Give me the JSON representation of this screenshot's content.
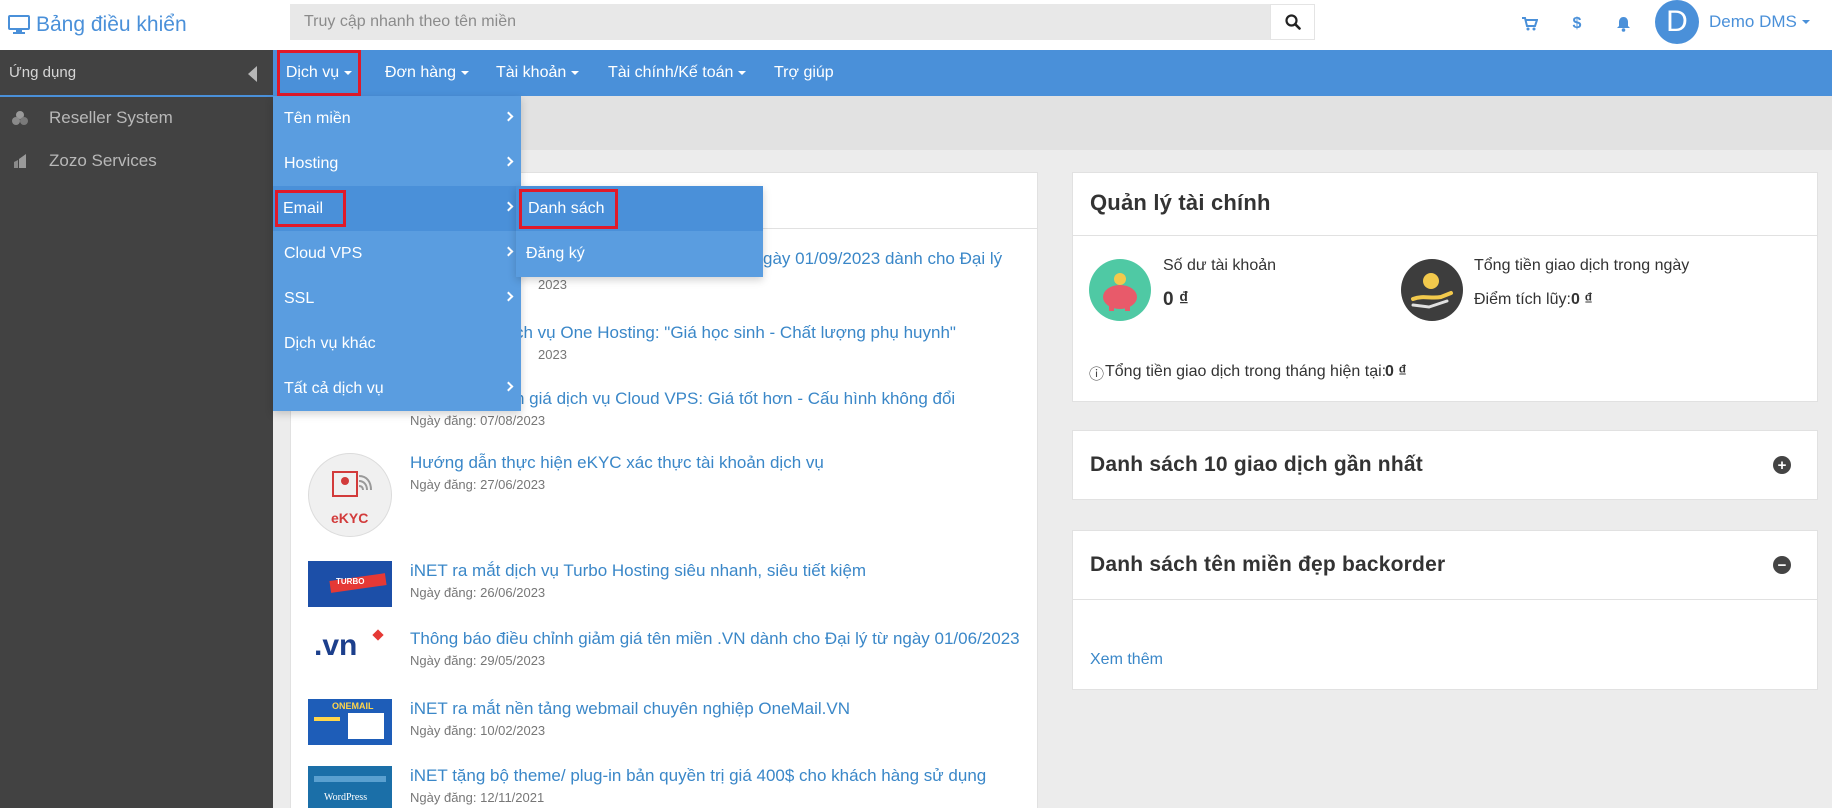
{
  "brand": {
    "title": "Bảng điều khiển"
  },
  "search": {
    "placeholder": "Truy cập nhanh theo tên miền"
  },
  "user": {
    "avatar_letter": "D",
    "name": "Demo DMS"
  },
  "topicons": {
    "dollar": "$"
  },
  "sidebar": {
    "heading": "Ứng dụng",
    "items": [
      {
        "label": "Reseller System",
        "icon": "reseller-icon"
      },
      {
        "label": "Zozo Services",
        "icon": "zozo-icon"
      }
    ]
  },
  "nav": {
    "items": [
      {
        "label": "Dịch vụ"
      },
      {
        "label": "Đơn hàng"
      },
      {
        "label": "Tài khoản"
      },
      {
        "label": "Tài chính/Kế toán"
      },
      {
        "label": "Trợ giúp"
      }
    ]
  },
  "dropdown": {
    "items": [
      {
        "label": "Tên miền"
      },
      {
        "label": "Hosting"
      },
      {
        "label": "Email"
      },
      {
        "label": "Cloud VPS"
      },
      {
        "label": "SSL"
      },
      {
        "label": "Dịch vụ khác"
      },
      {
        "label": "Tất cả dịch vụ"
      }
    ],
    "submenu": [
      {
        "label": "Danh sách"
      },
      {
        "label": "Đăng ký"
      }
    ]
  },
  "news": {
    "items": [
      {
        "title": "gày 01/09/2023 dành cho Đại lý",
        "date": "2023"
      },
      {
        "title": "ch vụ One Hosting: \"Giá học sinh - Chất lượng phụ huynh\"",
        "date": "2023"
      },
      {
        "title": "n giá dịch vụ Cloud VPS: Giá tốt hơn - Cấu hình không đổi",
        "date": "Ngày đăng: 07/08/2023"
      },
      {
        "title": "Hướng dẫn thực hiện eKYC xác thực tài khoản dịch vụ",
        "date": "Ngày đăng: 27/06/2023"
      },
      {
        "title": "iNET ra mắt dịch vụ Turbo Hosting siêu nhanh, siêu tiết kiệm",
        "date": "Ngày đăng: 26/06/2023"
      },
      {
        "title": "Thông báo điều chỉnh giảm giá tên miền .VN dành cho Đại lý từ ngày 01/06/2023",
        "date": "Ngày đăng: 29/05/2023"
      },
      {
        "title": "iNET ra mắt nền tảng webmail chuyên nghiệp OneMail.VN",
        "date": "Ngày đăng: 10/02/2023"
      },
      {
        "title": "iNET tặng bộ theme/ plug-in bản quyền trị giá 400$ cho khách hàng sử dụng",
        "date": "Ngày đăng: 12/11/2021"
      }
    ],
    "thumb_texts": {
      "ekyc": "eKYC",
      "vn": ".vn",
      "turbo": "TURBO",
      "onemail": "ONEMAIL",
      "wordpress": "WordPress"
    }
  },
  "finance": {
    "title": "Quản lý tài chính",
    "balance_label": "Số dư tài khoản",
    "balance_value": "0 ₫",
    "daily_label": "Tổng tiền giao dịch trong ngày",
    "points_label": "Điểm tích lũy:",
    "points_value": "0 ₫",
    "month_label": "Tổng tiền giao dịch trong tháng hiện tại:",
    "month_value": "0 ₫",
    "info_icon": "ⓘ"
  },
  "transactions": {
    "title": "Danh sách 10 giao dịch gần nhất",
    "toggle": "+"
  },
  "backorder": {
    "title": "Danh sách tên miền đẹp backorder",
    "toggle": "−",
    "more_link": "Xem thêm"
  }
}
